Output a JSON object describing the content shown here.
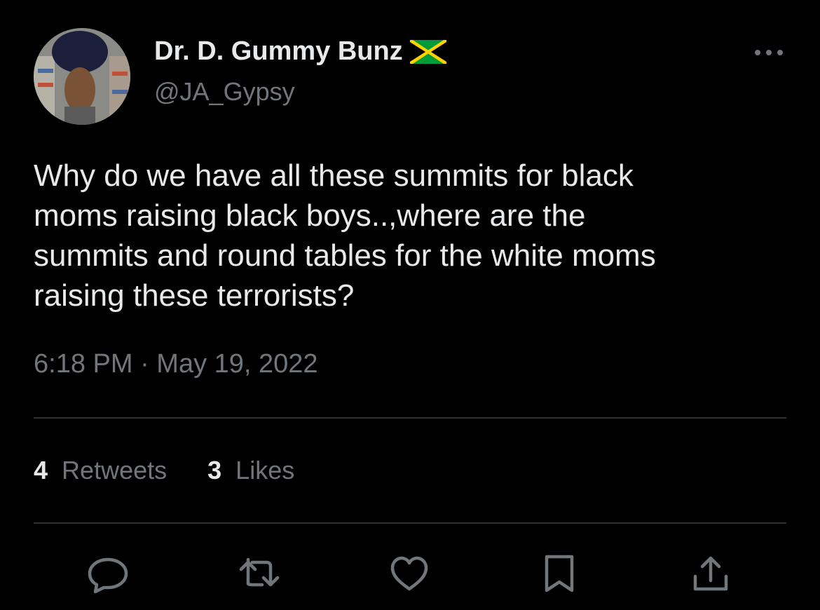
{
  "user": {
    "display_name": "Dr. D. Gummy Bunz",
    "handle": "@JA_Gypsy",
    "badge_icon": "jamaica-flag-icon"
  },
  "tweet": {
    "text": "Why do we have all these summits for black\nmoms raising black boys..,where are the\nsummits and round tables for the white moms\nraising these terrorists?",
    "timestamp": "6:18 PM · May 19, 2022"
  },
  "stats": {
    "retweets_count": "4",
    "retweets_label": "Retweets",
    "likes_count": "3",
    "likes_label": "Likes"
  },
  "actions": {
    "reply_icon": "reply-icon",
    "retweet_icon": "retweet-icon",
    "like_icon": "heart-icon",
    "bookmark_icon": "bookmark-icon",
    "share_icon": "share-icon"
  },
  "colors": {
    "background": "#000000",
    "primary_text": "#e7e9ea",
    "secondary_text": "#71767b",
    "divider": "#2f3336",
    "flag_green": "#009b3a",
    "flag_gold": "#fed100",
    "flag_black": "#000000"
  }
}
